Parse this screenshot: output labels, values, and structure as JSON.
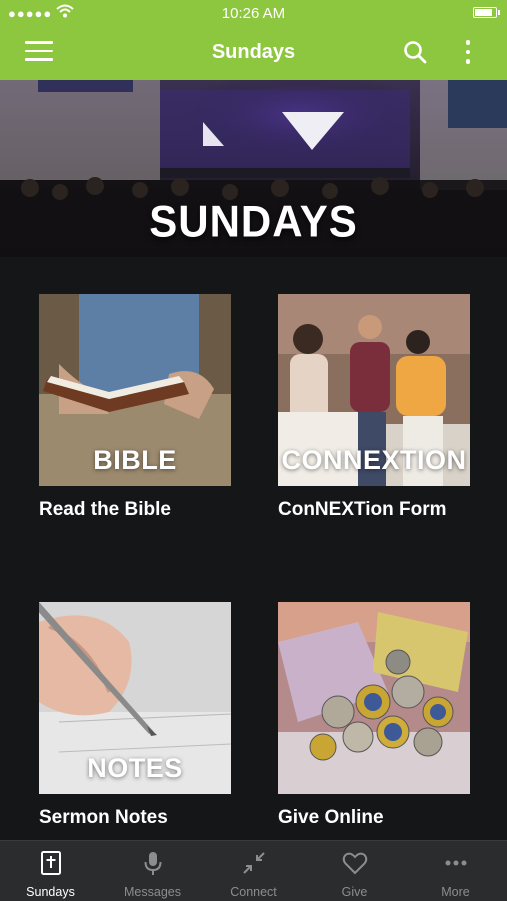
{
  "status_bar": {
    "time": "10:26 AM"
  },
  "nav": {
    "title": "Sundays"
  },
  "hero": {
    "banner": "SUNDAYS"
  },
  "tiles": [
    {
      "image_text": "BIBLE",
      "caption": "Read the Bible"
    },
    {
      "image_text": "CONNEXTION",
      "caption": "ConNEXTion Form"
    },
    {
      "image_text": "NOTES",
      "caption": "Sermon Notes"
    },
    {
      "image_text": "",
      "caption": "Give Online"
    }
  ],
  "tab_bar": {
    "items": [
      {
        "label": "Sundays",
        "icon": "bible-icon",
        "active": true
      },
      {
        "label": "Messages",
        "icon": "microphone-icon",
        "active": false
      },
      {
        "label": "Connect",
        "icon": "connect-arrows-icon",
        "active": false
      },
      {
        "label": "Give",
        "icon": "heart-icon",
        "active": false
      },
      {
        "label": "More",
        "icon": "ellipsis-icon",
        "active": false
      }
    ]
  },
  "colors": {
    "brand_green": "#8dc63f",
    "background": "#151617",
    "tab_bar": "#2b2c2e"
  }
}
